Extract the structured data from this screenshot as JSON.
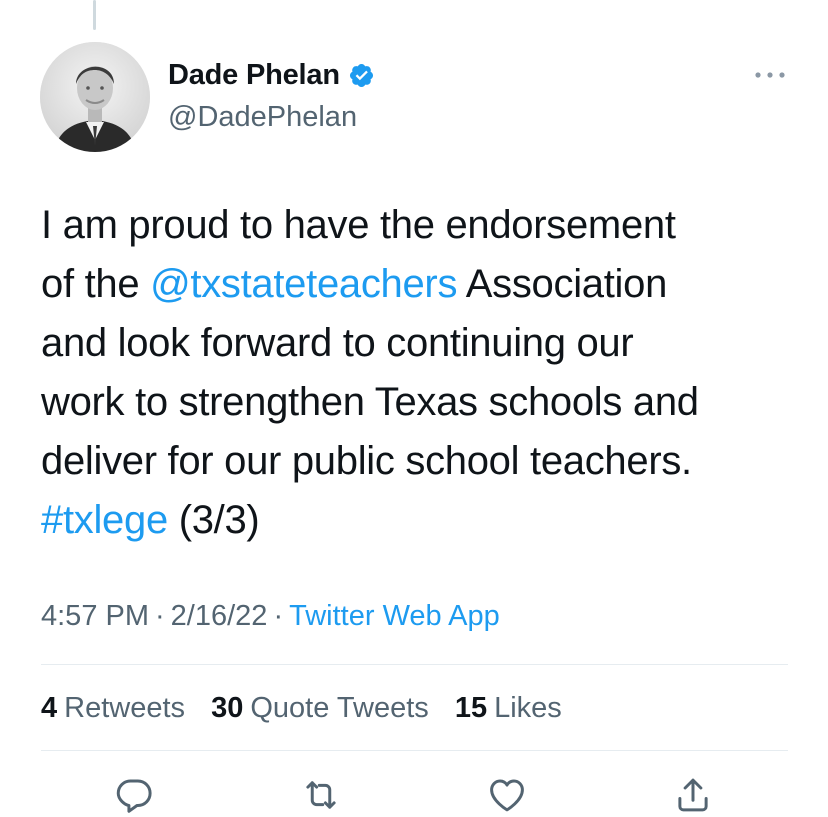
{
  "author": {
    "display_name": "Dade Phelan",
    "handle": "@DadePhelan",
    "verified": true
  },
  "tweet": {
    "segments": [
      {
        "text": "I am proud to have the endorsement",
        "link": false
      },
      {
        "text": "of the ",
        "link": false
      },
      {
        "text": "@txstateteachers",
        "link": true
      },
      {
        "text": " Association",
        "link": false
      },
      {
        "text": "and look forward to continuing our",
        "link": false
      },
      {
        "text": "work to strengthen Texas schools and",
        "link": false
      },
      {
        "text": "deliver for our public school teachers.",
        "link": false
      },
      {
        "text": "#txlege",
        "link": true
      },
      {
        "text": " (3/3)",
        "link": false
      }
    ]
  },
  "meta": {
    "time": "4:57 PM",
    "separator": "·",
    "date": "2/16/22",
    "source": "Twitter Web App"
  },
  "stats": {
    "retweets_count": "4",
    "retweets_label": "Retweets",
    "quotes_count": "30",
    "quotes_label": "Quote Tweets",
    "likes_count": "15",
    "likes_label": "Likes"
  },
  "icons": {
    "verified": "verified-badge-icon",
    "more": "more-options-icon",
    "reply": "reply-icon",
    "retweet": "retweet-icon",
    "like": "heart-icon",
    "share": "share-icon"
  },
  "colors": {
    "accent": "#1d9bf0",
    "text": "#0f1419",
    "secondary": "#536471"
  }
}
